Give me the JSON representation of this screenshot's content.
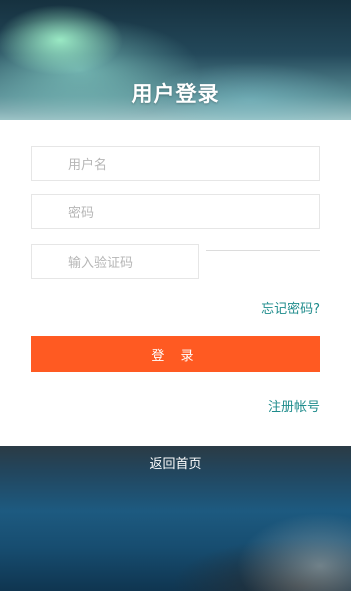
{
  "header": {
    "title": "用户登录"
  },
  "form": {
    "username_placeholder": "用户名",
    "password_placeholder": "密码",
    "captcha_placeholder": "输入验证码",
    "forgot_label": "忘记密码?",
    "login_label": "登 录",
    "register_label": "注册帐号"
  },
  "footer": {
    "home_label": "返回首页"
  },
  "colors": {
    "accent_button": "#ff5a22",
    "link": "#1f8c8c"
  }
}
